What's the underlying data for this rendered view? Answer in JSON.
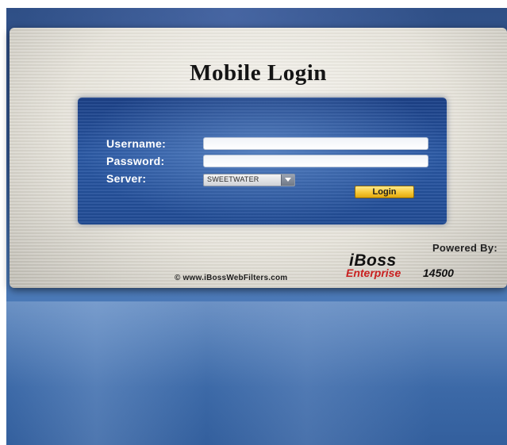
{
  "page": {
    "title": "Mobile Login"
  },
  "form": {
    "username_label": "Username:",
    "username_value": "",
    "password_label": "Password:",
    "password_value": "",
    "server_label": "Server:",
    "server_selected": "SWEETWATER",
    "login_label": "Login"
  },
  "footer": {
    "powered_by": "Powered By:",
    "brand_name": "iBoss",
    "brand_edition": "Enterprise",
    "brand_model": "14500",
    "copyright": "© www.iBossWebFilters.com"
  },
  "colors": {
    "form_blue": "#2a58a4",
    "login_button_yellow": "#f6c836",
    "brand_red": "#c92020",
    "backdrop_blue": "#355a96"
  },
  "icons": {
    "select_arrow": "chevron-down-icon"
  }
}
